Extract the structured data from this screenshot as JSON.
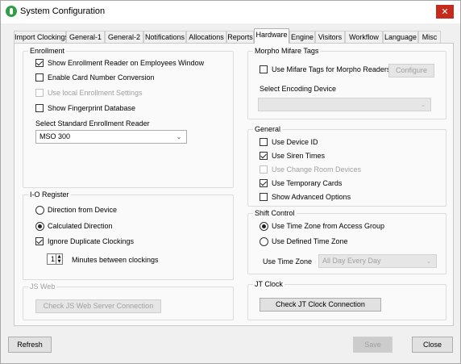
{
  "window": {
    "title": "System Configuration",
    "close_glyph": "✕"
  },
  "tabs": [
    "Import Clockings",
    "General-1",
    "General-2",
    "Notifications",
    "Allocations",
    "Reports",
    "Hardware",
    "Engine",
    "Visitors",
    "Workflow",
    "Language",
    "Misc"
  ],
  "active_tab": "Hardware",
  "enrollment": {
    "legend": "Enrollment",
    "options": [
      {
        "label": "Show Enrollment Reader on Employees Window",
        "checked": true,
        "enabled": true
      },
      {
        "label": "Enable Card Number Conversion",
        "checked": false,
        "enabled": true
      },
      {
        "label": "Use local Enrollment Settings",
        "checked": false,
        "enabled": false
      },
      {
        "label": "Show Fingerprint Database",
        "checked": false,
        "enabled": true
      }
    ],
    "reader_label": "Select Standard Enrollment Reader",
    "reader_value": "MSO 300"
  },
  "io_register": {
    "legend": "I-O Register",
    "radio_direction_device": "Direction from Device",
    "radio_calculated": "Calculated Direction",
    "selected_direction": "Calculated Direction",
    "ignore_duplicates_label": "Ignore Duplicate Clockings",
    "ignore_duplicates_checked": true,
    "minutes_value": "1",
    "minutes_label": "Minutes between clockings"
  },
  "js_web": {
    "legend": "JS Web",
    "check_button": "Check JS Web Server Connection"
  },
  "morpho": {
    "legend": "Morpho Mifare Tags",
    "use_mifare_label": "Use Mifare Tags for Morpho Readers",
    "use_mifare_checked": false,
    "configure_button": "Configure",
    "encoding_label": "Select Encoding Device",
    "encoding_value": ""
  },
  "general": {
    "legend": "General",
    "options": [
      {
        "label": "Use Device ID",
        "checked": false,
        "enabled": true
      },
      {
        "label": "Use Siren Times",
        "checked": true,
        "enabled": true
      },
      {
        "label": "Use Change Room Devices",
        "checked": false,
        "enabled": false
      },
      {
        "label": "Use Temporary Cards",
        "checked": true,
        "enabled": true
      },
      {
        "label": "Show Advanced Options",
        "checked": false,
        "enabled": true
      }
    ]
  },
  "shift_control": {
    "legend": "Shift Control",
    "radio_access_group": "Use Time Zone from Access Group",
    "radio_defined": "Use Defined Time Zone",
    "selected": "Use Time Zone from Access Group",
    "time_zone_label": "Use Time Zone",
    "time_zone_value": "All Day Every Day"
  },
  "jt_clock": {
    "legend": "JT Clock",
    "check_button": "Check JT Clock Connection"
  },
  "footer": {
    "refresh": "Refresh",
    "save": "Save",
    "close": "Close"
  },
  "icons": {
    "app": "app-logo-icon",
    "close": "close-icon",
    "dropdown": "chevron-down-icon",
    "spinner": "spinner-arrows-icon"
  }
}
